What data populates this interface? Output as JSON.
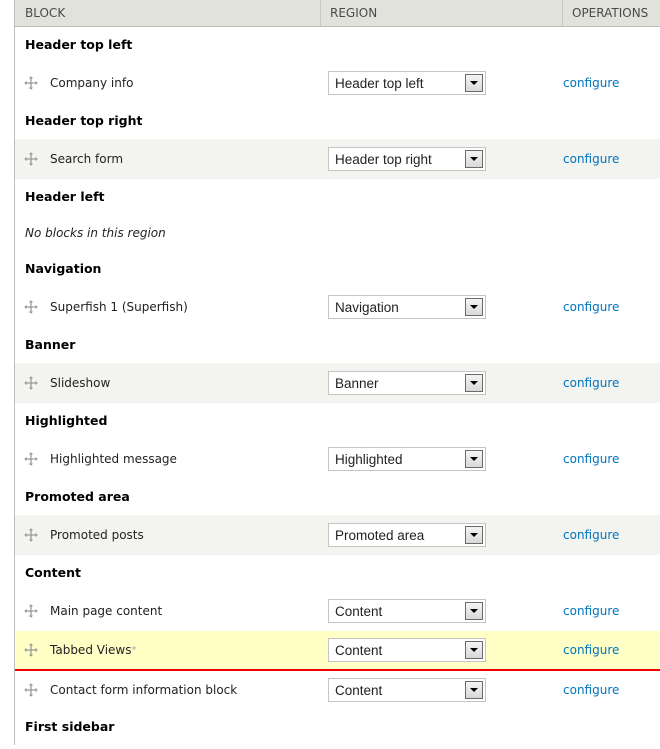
{
  "table": {
    "headers": {
      "block": "BLOCK",
      "region": "REGION",
      "operations": "OPERATIONS"
    }
  },
  "regions": [
    {
      "title": "Header top left",
      "blocks": [
        {
          "name": "Company info",
          "region": "Header top left",
          "op": "configure"
        }
      ]
    },
    {
      "title": "Header top right",
      "blocks": [
        {
          "name": "Search form",
          "region": "Header top right",
          "op": "configure"
        }
      ]
    },
    {
      "title": "Header left",
      "empty": "No blocks in this region"
    },
    {
      "title": "Navigation",
      "blocks": [
        {
          "name": "Superfish 1 (Superfish)",
          "region": "Navigation",
          "op": "configure"
        }
      ]
    },
    {
      "title": "Banner",
      "blocks": [
        {
          "name": "Slideshow",
          "region": "Banner",
          "op": "configure"
        }
      ]
    },
    {
      "title": "Highlighted",
      "blocks": [
        {
          "name": "Highlighted message",
          "region": "Highlighted",
          "op": "configure"
        }
      ]
    },
    {
      "title": "Promoted area",
      "blocks": [
        {
          "name": "Promoted posts",
          "region": "Promoted area",
          "op": "configure"
        }
      ]
    },
    {
      "title": "Content",
      "blocks": [
        {
          "name": "Main page content",
          "region": "Content",
          "op": "configure"
        },
        {
          "name": "Tabbed Views",
          "changed_marker": "*",
          "region": "Content",
          "op": "configure"
        },
        {
          "name": "Contact form information block",
          "region": "Content",
          "op": "configure"
        }
      ]
    },
    {
      "title": "First sidebar"
    }
  ],
  "icons": {
    "drag": "drag-handle-icon",
    "dropdown": "dropdown-arrow-icon"
  },
  "colors": {
    "link": "#0074bd",
    "highlight_row": "#ffffc6",
    "drop_indicator": "#ee0000",
    "stripe": "#f3f3ef",
    "header_bg": "#e1e2dc"
  }
}
